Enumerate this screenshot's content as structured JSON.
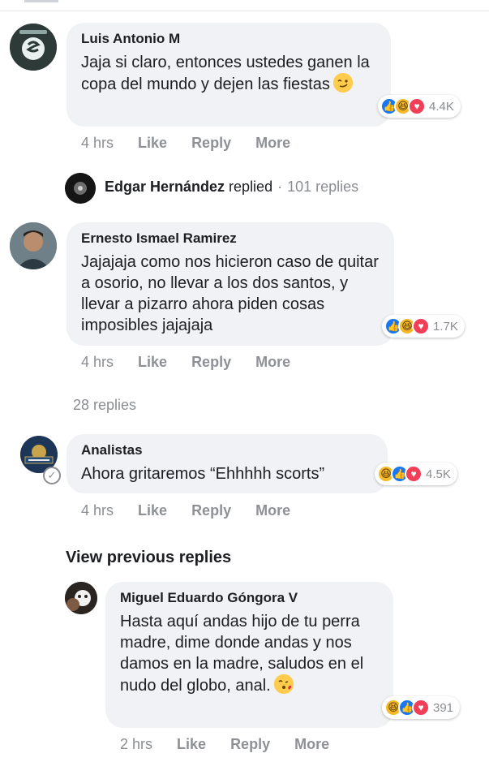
{
  "comments": [
    {
      "author": "Luis Antonio M",
      "text": "Jaja si claro, entonces ustedes ganen la copa del mundo y dejen las fiestas",
      "reaction_count": "4.4K",
      "time": "4 hrs",
      "like": "Like",
      "reply": "Reply",
      "more": "More"
    },
    {
      "author": "Ernesto Ismael Ramirez",
      "text": "Jajajaja como nos hicieron caso de quitar a osorio, no llevar a los dos santos, y llevar a pizarro ahora piden cosas imposibles jajajaja",
      "reaction_count": "1.7K",
      "time": "4 hrs",
      "like": "Like",
      "reply": "Reply",
      "more": "More"
    },
    {
      "author": "Analistas",
      "text": "Ahora gritaremos “Ehhhhh scorts”",
      "reaction_count": "4.5K",
      "time": "4 hrs",
      "like": "Like",
      "reply": "Reply",
      "more": "More"
    },
    {
      "author": "Miguel Eduardo Góngora V",
      "text": "Hasta aquí andas hijo de tu perra madre, dime donde andas y nos damos en la madre, saludos en el nudo del globo, anal.",
      "reaction_count": "391",
      "time": "2 hrs",
      "like": "Like",
      "reply": "Reply",
      "more": "More"
    }
  ],
  "replied": {
    "name": "Edgar Hernández",
    "verb": "replied",
    "separator": "·",
    "count": "101 replies"
  },
  "replies_28": "28 replies",
  "view_previous": "View previous replies",
  "icons": {
    "like": "thumbs-up-icon",
    "haha": "laughing-face-icon",
    "love": "heart-icon",
    "verified": "verified-check-icon"
  },
  "colors": {
    "like_blue": "#1877f2",
    "haha_yellow": "#f7b928",
    "love_red": "#f33e58",
    "bubble_bg": "#f0f2f5",
    "meta_gray": "#8a8d91"
  }
}
